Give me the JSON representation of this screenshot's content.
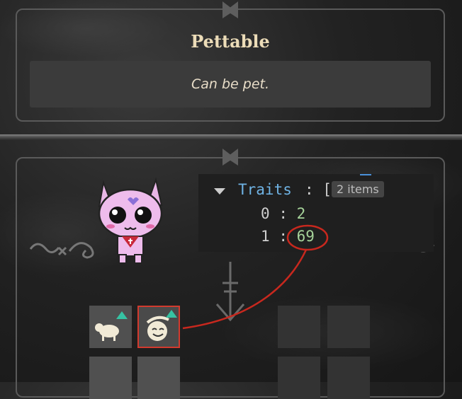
{
  "tooltip": {
    "title": "Pettable",
    "description": "Can be pet."
  },
  "inspector": {
    "key": "Traits",
    "separator": ":",
    "open_bracket": "[",
    "count_label": "2 items",
    "items": [
      {
        "index": "0",
        "separator": ":",
        "value": "2"
      },
      {
        "index": "1",
        "separator": ":",
        "value": "69"
      }
    ]
  },
  "colors": {
    "key": "#6fb3e4",
    "value": "#a6d39a",
    "selection": "#d23a2e",
    "upgrade_arrow": "#36c3a3",
    "title": "#ecdcb8"
  },
  "icons": {
    "slot_1": "sheep-icon",
    "slot_2": "smiling-face-icon",
    "cat": "pink-cat-character",
    "annotation": "red-circle-and-line"
  }
}
